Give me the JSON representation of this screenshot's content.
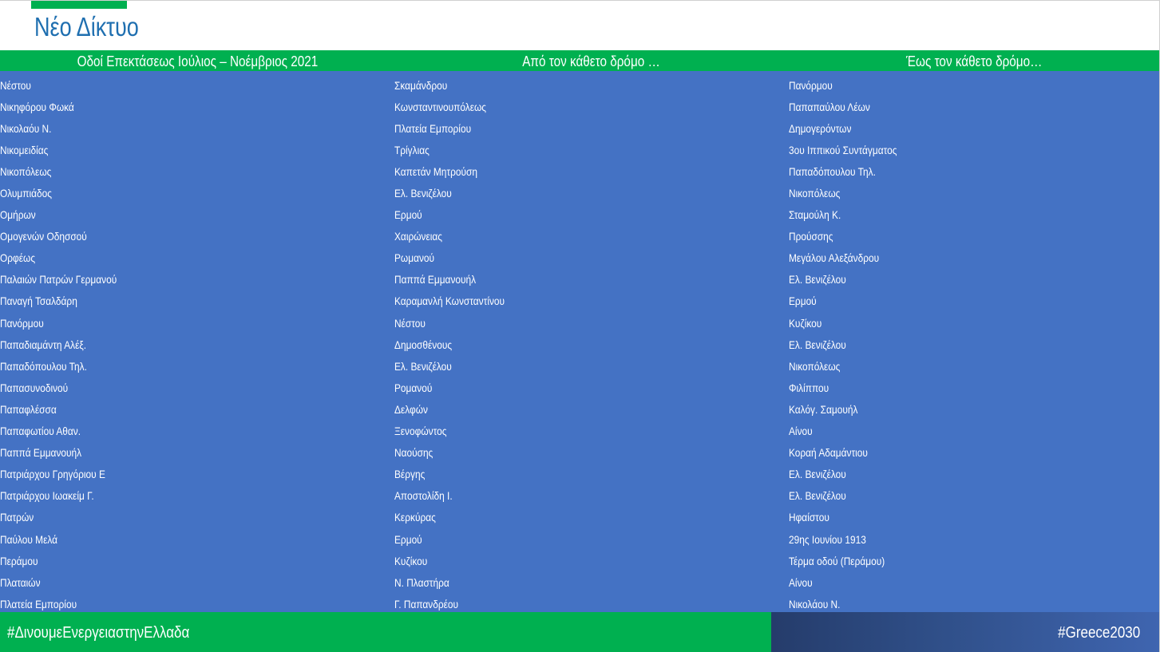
{
  "title": "Νέο Δίκτυο",
  "colors": {
    "accent_green": "#00b050",
    "table_blue": "#4472c4",
    "title_blue": "#1f6fb0",
    "footer_navy": "#2a4577"
  },
  "table": {
    "headers": [
      "Οδοί Επεκτάσεως Ιούλιος – Νοέμβριος 2021",
      "Από τον κάθετο δρόμο …",
      "Έως τον κάθετο δρόμο…"
    ],
    "rows": [
      [
        "Νέστου",
        "Σκαμάνδρου",
        "Πανόρμου"
      ],
      [
        "Νικηφόρου Φωκά",
        "Κωνσταντινουπόλεως",
        "Παπαπαύλου Λέων"
      ],
      [
        "Νικολαόυ Ν.",
        "Πλατεία Εμπορίου",
        "Δημογερόντων"
      ],
      [
        "Νικομειδίας",
        "Τρίγλιας",
        "3ου Ιππικού Συντάγματος"
      ],
      [
        "Νικοπόλεως",
        "Καπετάν Μητρούση",
        "Παπαδόπουλου Τηλ."
      ],
      [
        "Ολυμπιάδος",
        "Ελ. Βενιζέλου",
        "Νικοπόλεως"
      ],
      [
        "Ομήρων",
        "Ερμού",
        "Σταμούλη Κ."
      ],
      [
        "Ομογενών Οδησσού",
        "Χαιρώνειας",
        "Προύσσης"
      ],
      [
        "Ορφέως",
        "Ρωμανού",
        "Μεγάλου Αλεξάνδρου"
      ],
      [
        "Παλαιών Πατρών Γερμανού",
        "Παππά Εμμανουήλ",
        "Ελ. Βενιζέλου"
      ],
      [
        "Παναγή Τσαλδάρη",
        "Καραμανλή Κωνσταντίνου",
        "Ερμού"
      ],
      [
        "Πανόρμου",
        "Νέστου",
        "Κυζίκου"
      ],
      [
        "Παπαδιαμάντη Αλέξ.",
        "Δημοσθένους",
        "Ελ. Βενιζέλου"
      ],
      [
        "Παπαδόπουλου Τηλ.",
        "Ελ. Βενιζέλου",
        "Νικοπόλεως"
      ],
      [
        "Παπασυνοδινού",
        "Ρομανού",
        "Φιλίππου"
      ],
      [
        "Παπαφλέσσα",
        "Δελφών",
        "Καλόγ. Σαμουήλ"
      ],
      [
        "Παπαφωτίου Αθαν.",
        "Ξενοφώντος",
        "Αίνου"
      ],
      [
        "Παππά Εμμανουήλ",
        "Ναούσης",
        "Κοραή Αδαμάντιου"
      ],
      [
        "Πατριάρχου Γρηγόριου Ε",
        "Βέργης",
        "Ελ. Βενιζέλου"
      ],
      [
        "Πατριάρχου Ιωακείμ Γ.",
        "Αποστολίδη Ι.",
        "Ελ. Βενιζέλου"
      ],
      [
        "Πατρών",
        "Κερκύρας",
        "Ηφαίστου"
      ],
      [
        "Παύλου Μελά",
        "Ερμού",
        "29ης Ιουνίου 1913"
      ],
      [
        "Περάμου",
        "Κυζίκου",
        "Τέρμα οδού (Περάμου)"
      ],
      [
        "Πλαταιών",
        "Ν. Πλαστήρα",
        "Αίνου"
      ],
      [
        "Πλατεία Εμπορίου",
        "Γ. Παπανδρέου",
        "Νικολάου Ν."
      ]
    ]
  },
  "footer": {
    "left_tag": "#ΔινουμεΕνεργειαστηνΕλλαδα",
    "right_tag": "#Greece2030"
  }
}
